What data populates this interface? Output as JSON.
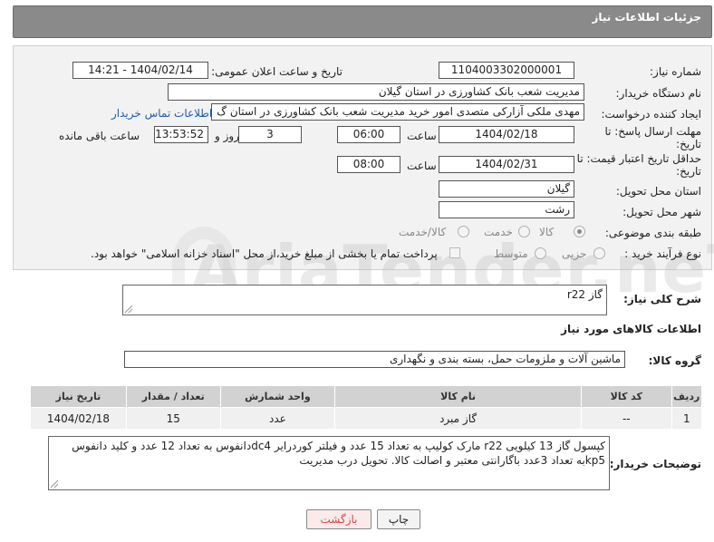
{
  "header": {
    "title": "جزئیات اطلاعات نیاز"
  },
  "watermark_text": "AriaTender.neT",
  "form": {
    "need_number_label": "شماره نیاز:",
    "need_number_value": "1104003302000001",
    "announce_label": "تاریخ و ساعت اعلان عمومی:",
    "announce_value": "1404/02/14 - 14:21",
    "buyer_org_label": "نام دستگاه خریدار:",
    "buyer_org_value": "مدیریت شعب بانک کشاورزی در استان گیلان",
    "creator_label": "ایجاد کننده درخواست:",
    "creator_value": "مهدی ملکی آزارکی متصدی امور خرید مدیریت شعب بانک کشاورزی در استان گ",
    "contact_link": "اطلاعات تماس خریدار",
    "reply_deadline_label": "مهلت ارسال پاسخ: تا تاریخ:",
    "reply_date": "1404/02/18",
    "time_label": "ساعت",
    "reply_time": "06:00",
    "days_value": "3",
    "days_label": "روز و",
    "remaining_time": "13:53:52",
    "remaining_label": "ساعت باقی مانده",
    "price_validity_label": "حداقل تاریخ اعتبار قیمت: تا تاریخ:",
    "price_date": "1404/02/31",
    "price_time": "08:00",
    "delivery_province_label": "استان محل تحویل:",
    "delivery_province_value": "گیلان",
    "delivery_city_label": "شهر محل تحویل:",
    "delivery_city_value": "رشت",
    "category_label": "طبقه بندی موضوعی:",
    "category_options": [
      "کالا",
      "خدمت",
      "کالا/خدمت"
    ],
    "category_selected": "کالا",
    "process_label": "نوع فرآیند خرید :",
    "process_options": [
      "جزیی",
      "متوسط"
    ],
    "payment_note": "پرداخت تمام یا بخشی از مبلغ خرید،از محل \"اسناد خزانه اسلامی\" خواهد بود."
  },
  "summary": {
    "label": "شرح کلی نیاز:",
    "value": "گاز  r22"
  },
  "goods_section_title": "اطلاعات کالاهای مورد نیاز",
  "goods_group": {
    "label": "گروه کالا:",
    "value": "ماشین آلات و ملزومات حمل، بسته بندی و نگهداری"
  },
  "table": {
    "headers": [
      "ردیف",
      "کد کالا",
      "نام کالا",
      "واحد شمارش",
      "تعداد / مقدار",
      "تاریخ نیاز"
    ],
    "rows": [
      [
        "1",
        "--",
        "گاز مبرد",
        "عدد",
        "15",
        "1404/02/18"
      ]
    ]
  },
  "buyer_notes": {
    "label": "توضیحات خریدار:",
    "line1": "کپسول گاز  13 کیلویی  r22  مارک کولیپ به تعداد 15 عدد و فیلتر کوردرایر   dc4دانفوس به تعداد 12 عدد و کلید دانفوس",
    "line2": "kp5به  تعداد 3عدد باگارانتی معتبر و اصالت کالا.  تحویل  درب مدیریت"
  },
  "buttons": {
    "print": "چاپ",
    "back": "بازگشت"
  }
}
